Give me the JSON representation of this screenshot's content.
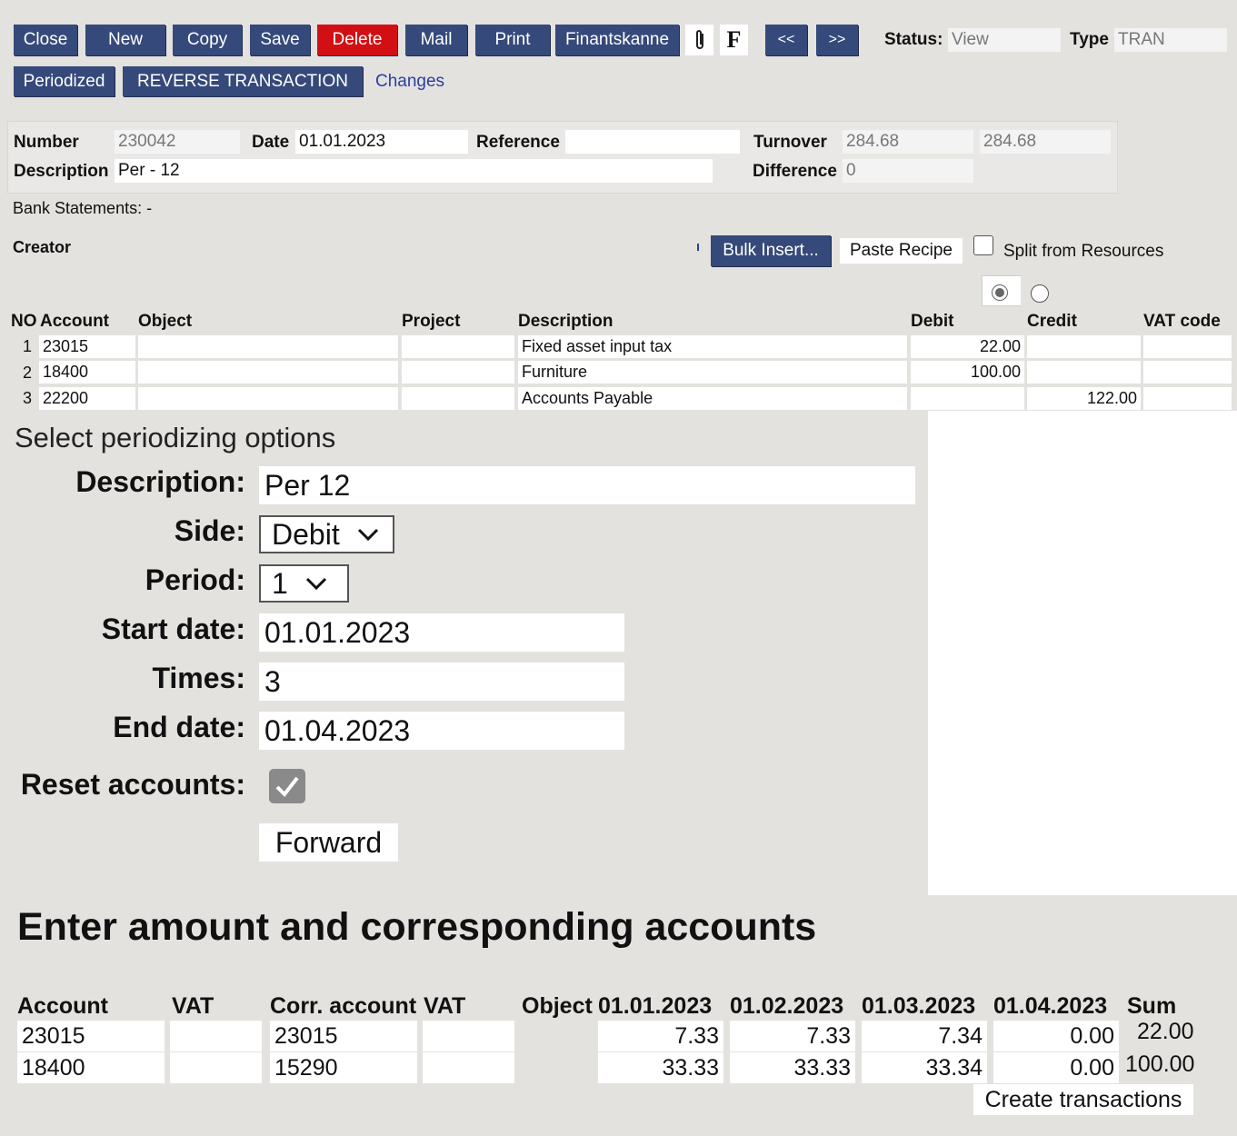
{
  "toolbar": {
    "close": "Close",
    "new": "New",
    "copy": "Copy",
    "save": "Save",
    "delete": "Delete",
    "mail": "Mail",
    "print": "Print",
    "finantskanne": "Finantskanne",
    "f_label": "F",
    "prev": "<<",
    "next": ">>",
    "status_label": "Status:",
    "status_value": "View",
    "type_label": "Type",
    "type_value": "TRAN",
    "periodized": "Periodized",
    "reverse": "REVERSE TRANSACTION",
    "changes": "Changes"
  },
  "header": {
    "number_label": "Number",
    "number_value": "230042",
    "date_label": "Date",
    "date_value": "01.01.2023",
    "reference_label": "Reference",
    "reference_value": "",
    "turnover_label": "Turnover",
    "turnover_value1": "284.68",
    "turnover_value2": "284.68",
    "description_label": "Description",
    "description_value": "Per - 12",
    "difference_label": "Difference",
    "difference_value": "0"
  },
  "bank_statements": "Bank Statements: -",
  "creator_label": "Creator",
  "actions": {
    "bulk_insert": "Bulk Insert...",
    "paste_recipe": "Paste Recipe",
    "split_resources": "Split from Resources"
  },
  "rows_table": {
    "headers": {
      "no": "NO",
      "account": "Account",
      "object": "Object",
      "project": "Project",
      "description": "Description",
      "debit": "Debit",
      "credit": "Credit",
      "vat_code": "VAT code"
    },
    "rows": [
      {
        "no": "1",
        "account": "23015",
        "description": "Fixed asset input tax",
        "debit": "22.00",
        "credit": ""
      },
      {
        "no": "2",
        "account": "18400",
        "description": "Furniture",
        "debit": "100.00",
        "credit": ""
      },
      {
        "no": "3",
        "account": "22200",
        "description": "Accounts Payable",
        "debit": "",
        "credit": "122.00"
      }
    ]
  },
  "periodizing": {
    "title": "Select periodizing options",
    "description_label": "Description:",
    "description_value": "Per 12",
    "side_label": "Side:",
    "side_value": "Debit",
    "period_label": "Period:",
    "period_value": "1",
    "start_label": "Start date:",
    "start_value": "01.01.2023",
    "times_label": "Times:",
    "times_value": "3",
    "end_label": "End date:",
    "end_value": "01.04.2023",
    "reset_label": "Reset accounts:",
    "reset_checked": true,
    "forward": "Forward"
  },
  "amounts": {
    "title": "Enter amount and corresponding accounts",
    "headers": {
      "account": "Account",
      "vat": "VAT",
      "corr_account": "Corr. account",
      "vat2": "VAT",
      "object": "Object",
      "d1": "01.01.2023",
      "d2": "01.02.2023",
      "d3": "01.03.2023",
      "d4": "01.04.2023",
      "sum": "Sum"
    },
    "rows": [
      {
        "account": "23015",
        "corr_account": "23015",
        "d1": "7.33",
        "d2": "7.33",
        "d3": "7.34",
        "d4": "0.00",
        "sum": "22.00"
      },
      {
        "account": "18400",
        "corr_account": "15290",
        "d1": "33.33",
        "d2": "33.33",
        "d3": "33.34",
        "d4": "0.00",
        "sum": "100.00"
      }
    ],
    "create": "Create transactions"
  }
}
